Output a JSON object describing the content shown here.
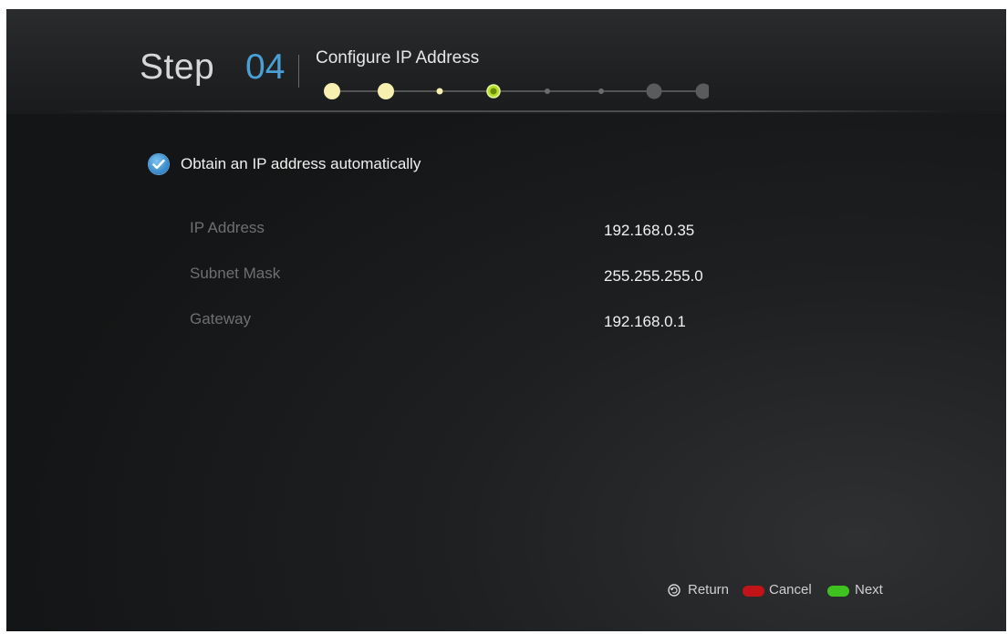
{
  "header": {
    "step_word": "Step",
    "step_number": "04",
    "title": "Configure IP Address"
  },
  "progress": {
    "current_step": 4,
    "total_steps": 8,
    "colors": {
      "done": "#f7efb0",
      "current": "#b8e02a",
      "upcoming": "#5a5b5d",
      "line": "#8a8a8a"
    }
  },
  "options": {
    "auto_ip_label": "Obtain an IP address automatically",
    "auto_ip_checked": true
  },
  "fields": [
    {
      "label": "IP Address",
      "value": "192.168.0.35"
    },
    {
      "label": "Subnet Mask",
      "value": "255.255.255.0"
    },
    {
      "label": "Gateway",
      "value": "192.168.0.1"
    }
  ],
  "footer": {
    "return_label": "Return",
    "cancel_label": "Cancel",
    "next_label": "Next",
    "cancel_color": "#c1141a",
    "next_color": "#3ec21f"
  },
  "colors": {
    "accent": "#4a9fd4",
    "label": "#6e6f71",
    "value": "#f2f2f2"
  }
}
